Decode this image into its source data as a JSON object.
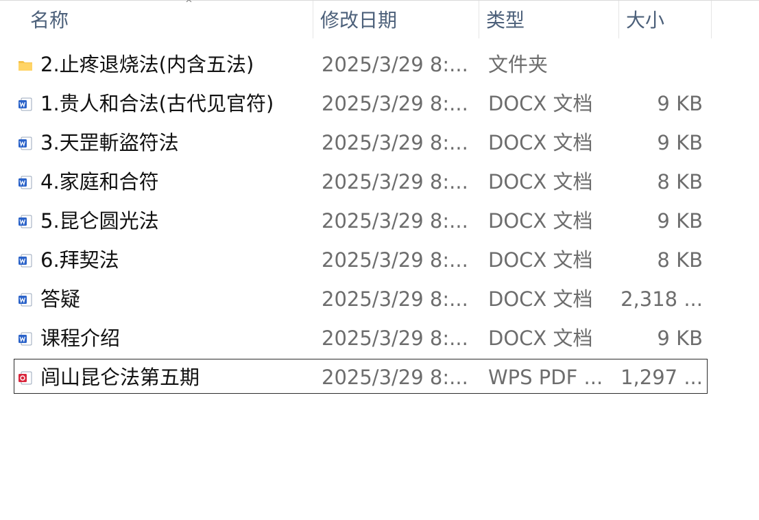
{
  "columns": {
    "name": "名称",
    "modified": "修改日期",
    "type": "类型",
    "size": "大小"
  },
  "files": [
    {
      "icon": "folder-icon",
      "name": "2.止疼退烧法(内含五法)",
      "modified": "2025/3/29 8:...",
      "type": "文件夹",
      "size": ""
    },
    {
      "icon": "word-doc-icon",
      "name": "1.贵人和合法(古代见官符)",
      "modified": "2025/3/29 8:...",
      "type": "DOCX 文档",
      "size": "9 KB"
    },
    {
      "icon": "word-doc-icon",
      "name": "3.天罡斬盜符法",
      "modified": "2025/3/29 8:...",
      "type": "DOCX 文档",
      "size": "9 KB"
    },
    {
      "icon": "word-doc-icon",
      "name": "4.家庭和合符",
      "modified": "2025/3/29 8:...",
      "type": "DOCX 文档",
      "size": "8 KB"
    },
    {
      "icon": "word-doc-icon",
      "name": "5.昆仑圆光法",
      "modified": "2025/3/29 8:...",
      "type": "DOCX 文档",
      "size": "9 KB"
    },
    {
      "icon": "word-doc-icon",
      "name": "6.拜契法",
      "modified": "2025/3/29 8:...",
      "type": "DOCX 文档",
      "size": "8 KB"
    },
    {
      "icon": "word-doc-icon",
      "name": "答疑",
      "modified": "2025/3/29 8:...",
      "type": "DOCX 文档",
      "size": "2,318 ..."
    },
    {
      "icon": "word-doc-icon",
      "name": "课程介绍",
      "modified": "2025/3/29 8:...",
      "type": "DOCX 文档",
      "size": "9 KB"
    },
    {
      "icon": "pdf-icon",
      "name": "闾山昆仑法第五期",
      "modified": "2025/3/29 8:...",
      "type": "WPS PDF ...",
      "size": "1,297 ...",
      "selected": true
    }
  ],
  "colors": {
    "header_text": "#4c607a",
    "name_text": "#111111",
    "detail_text": "#6d6d6d",
    "folder": "#f4c24a",
    "word": "#2b63c9",
    "pdf": "#d9263d"
  }
}
